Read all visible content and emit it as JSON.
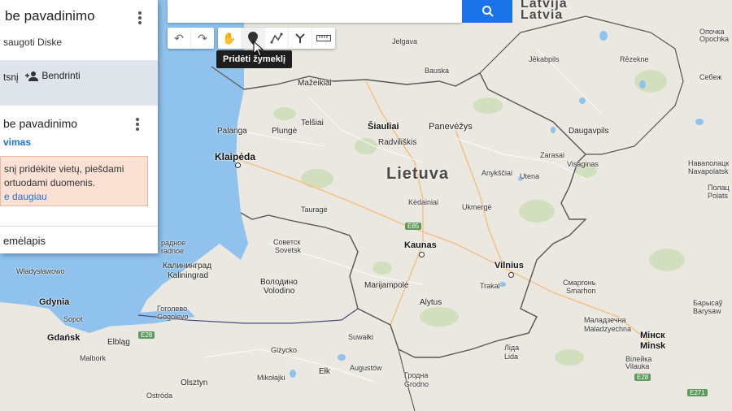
{
  "panel": {
    "title": "be pavadinimo",
    "saved": "saugoti Diske",
    "share_prefix": "tsnį",
    "share_label": "Bendrinti",
    "layer_title": "be pavadinimo",
    "layer_link": "vimas",
    "note_line1": "snį pridėkite vietų, piešdami",
    "note_line2": "ortuodami duomenis.",
    "note_link": "e daugiau",
    "basemap": "emėlapis"
  },
  "toolbar": {
    "tooltip": "Pridėti žymeklį",
    "buttons": [
      "undo-icon",
      "redo-icon",
      "hand-icon",
      "marker-icon",
      "line-icon",
      "directions-icon",
      "ruler-icon"
    ]
  },
  "map": {
    "country_main": "Lietuva",
    "country_north": "Latvija",
    "country_north2": "Latvia",
    "cities": {
      "klaipeda": "Klaipėda",
      "palanga": "Palanga",
      "plunge": "Plungė",
      "telsiai": "Telšiai",
      "siauliai": "Šiauliai",
      "radviliskis": "Radviliškis",
      "panevezys": "Panevėžys",
      "zarasai": "Zarasai",
      "daugavpils": "Daugavpils",
      "visaginas": "Visaginas",
      "anyksciai": "Anykščiai",
      "utena": "Utena",
      "kedainiai": "Kėdainiai",
      "ukmerge": "Ukmergė",
      "taurage": "Tauragė",
      "kaunas": "Kaunas",
      "vilnius": "Vilnius",
      "trakai": "Trakai",
      "marijampole": "Marijampolė",
      "alytus": "Alytus",
      "mazeikiai": "Mažeikiai",
      "jelgava": "Jelgava",
      "bauska": "Bauska",
      "jekabpils": "Jēkabpils",
      "rezekne": "Rēzekne",
      "sovetsk_ru": "Советск",
      "sovetsk": "Sovetsk",
      "kaliningrad_ru": "Калининград",
      "kaliningrad": "Kaliningrad",
      "volodino_ru": "Володино",
      "volodino": "Volodino",
      "gogolevo_ru": "Гоголево",
      "gogolevo": "Gogolevo",
      "gradnoe_ru": "радное",
      "gradnoe": "radnoe",
      "wladyslawowo": "Władysławowo",
      "gdynia": "Gdynia",
      "sopot": "Sopot",
      "gdansk": "Gdańsk",
      "elblag": "Elbląg",
      "malbork": "Malbork",
      "olsztyn": "Olsztyn",
      "ostroda": "Ostróda",
      "gizycko": "Giżycko",
      "mikolajki": "Mikołajki",
      "elk": "Ełk",
      "augustow": "Augustów",
      "suwalki": "Suwałki",
      "grodno_ru": "Гродна",
      "grodno": "Grodno",
      "lida_ru": "Ліда",
      "lida": "Lida",
      "smarhon_ru": "Смаргонь",
      "smarhon": "Smarhon",
      "maladziecna_ru": "Маладзечна",
      "maladziecna": "Maladzyechna",
      "minsk_ru": "Мінск",
      "minsk": "Minsk",
      "vileyka_ru": "Вілейка",
      "vileyka": "Vilauka",
      "novopolotsk_ru": "Наваполацк",
      "novopolotsk": "Navapolatsk",
      "polotsk_ru": "Полац",
      "polotsk": "Polats",
      "barysaw_ru": "Барысаў",
      "barysaw": "Barysaw",
      "opochka_ru": "Опочка",
      "opochka": "Opochka",
      "sebezh": "Себеж"
    },
    "roads": {
      "e85": "E85",
      "e28": "E28",
      "e271": "E271",
      "e28b": "E28"
    }
  }
}
